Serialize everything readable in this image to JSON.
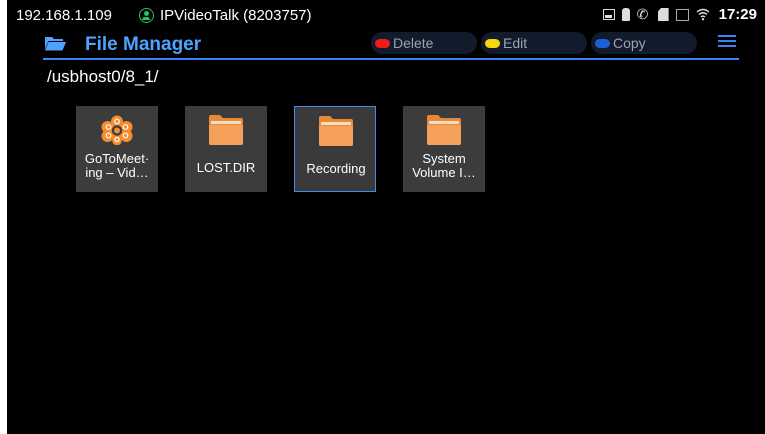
{
  "status_bar": {
    "ip": "192.168.1.109",
    "account": "IPVideoTalk (8203757)",
    "time": "17:29",
    "icons": [
      "screen-icon",
      "usb-icon",
      "phone-icon",
      "sd-card-icon",
      "network-icon",
      "wifi-icon"
    ]
  },
  "header": {
    "title": "File Manager",
    "actions": {
      "delete": {
        "label": "Delete",
        "color": "#ef1b1b"
      },
      "edit": {
        "label": "Edit",
        "color": "#f5d60a"
      },
      "copy": {
        "label": "Copy",
        "color": "#1f5fd6"
      }
    },
    "accent": "#3b82f6"
  },
  "path": "/usbhost0/8_1/",
  "files": [
    {
      "name_line1": "GoToMeet·",
      "name_line2": "ing – Vid…",
      "type": "app"
    },
    {
      "name": "LOST.DIR",
      "type": "folder"
    },
    {
      "name": "Recording",
      "type": "folder",
      "selected": true
    },
    {
      "name_line1": "System",
      "name_line2": "Volume I…",
      "type": "folder"
    }
  ]
}
